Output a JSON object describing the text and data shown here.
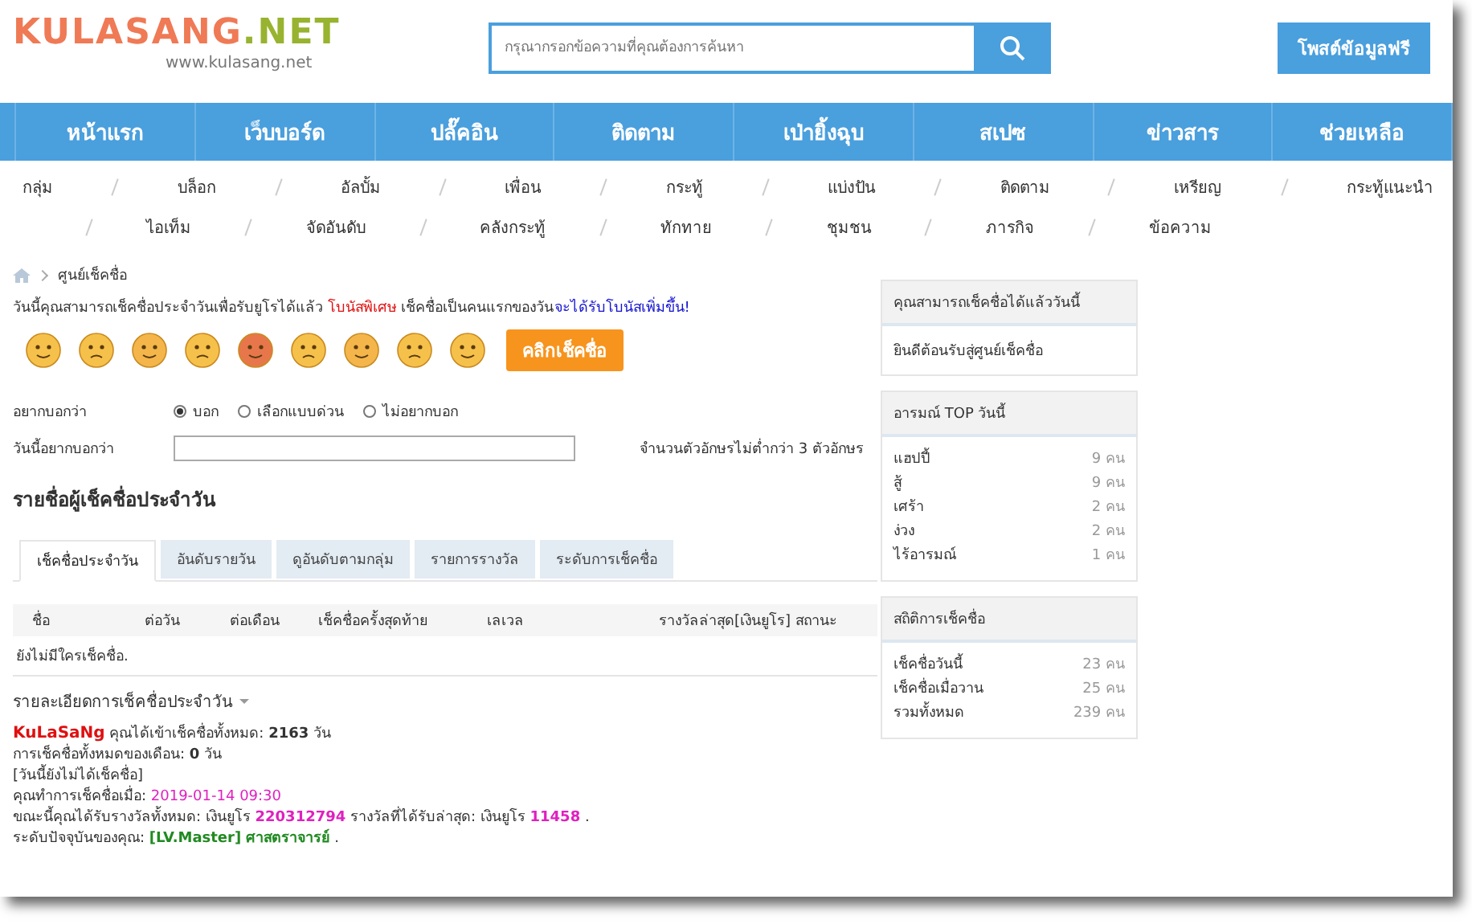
{
  "header": {
    "logo": {
      "name": "KULASANG",
      "suffix": ".NET",
      "url": "www.kulasang.net"
    },
    "search": {
      "placeholder": "กรุณากรอกข้อความที่คุณต้องการค้นหา"
    },
    "post_button": "โพสต์ข้อมูลฟรี"
  },
  "main_nav": [
    "หน้าแรก",
    "เว็บบอร์ด",
    "ปลั๊คอิน",
    "ติดตาม",
    "เป่ายิ้งฉุบ",
    "สเปซ",
    "ข่าวสาร",
    "ช่วยเหลือ"
  ],
  "sub_nav": [
    [
      "กลุ่ม",
      "บล็อก",
      "อัลบั้ม",
      "เพื่อน",
      "กระทู้",
      "แบ่งปัน",
      "ติดตาม",
      "เหรียญ",
      "กระทู้แนะนำ"
    ],
    [
      "ไอเท็ม",
      "จัดอันดับ",
      "คลังกระทู้",
      "ทักทาย",
      "ชุมชน",
      "ภารกิจ",
      "ข้อความ"
    ]
  ],
  "breadcrumb": [
    "ศูนย์เช็คชื่อ"
  ],
  "intro": [
    {
      "kind": "plain",
      "text": "วันนี้คุณสามารถเช็คชื่อประจำวันเพื่อรับยูโรได้แล้ว "
    },
    {
      "kind": "red",
      "text": "โบนัสพิเศษ"
    },
    {
      "kind": "plain",
      "text": " เช็คชื่อเป็นคนแรกของวัน"
    },
    {
      "kind": "blue",
      "text": "จะได้รับโบนัสเพิ่มขึ้น!"
    }
  ],
  "checkin_button": "คลิกเช็คชื่อ",
  "say_label": "อยากบอกว่า",
  "say_options": [
    {
      "label": "บอก",
      "selected": true
    },
    {
      "label": "เลือกแบบด่วน",
      "selected": false
    },
    {
      "label": "ไม่อยากบอก",
      "selected": false
    }
  ],
  "message_label": "วันนี้อยากบอกว่า",
  "message_hint": "จำนวนตัวอักษรไม่ต่ำกว่า 3 ตัวอักษร",
  "list_title": "รายชื่อผู้เช็คชื่อประจำวัน",
  "tabs": [
    {
      "label": "เช็คชื่อประจำวัน",
      "selected": true
    },
    {
      "label": "อันดับรายวัน",
      "selected": false
    },
    {
      "label": "ดูอันดับตามกลุ่ม",
      "selected": false
    },
    {
      "label": "รายการรางวัล",
      "selected": false
    },
    {
      "label": "ระดับการเช็คชื่อ",
      "selected": false
    }
  ],
  "table": {
    "columns": [
      "ชื่อ",
      "ต่อวัน",
      "ต่อเดือน",
      "เช็คชื่อครั้งสุดท้าย",
      "เลเวล",
      "รางวัลล่าสุด[เงินยูโร]",
      "สถานะ"
    ],
    "empty": "ยังไม่มีใครเช็คชื่อ."
  },
  "details": {
    "title": "รายละเอียดการเช็คชื่อประจำวัน",
    "lines": [
      [
        {
          "kind": "name",
          "text": "KuLaSaNg"
        },
        {
          "kind": "plain",
          "text": " คุณได้เข้าเช็คชื่อทั้งหมด: "
        },
        {
          "kind": "bold",
          "text": "2163"
        },
        {
          "kind": "plain",
          "text": " วัน"
        }
      ],
      [
        {
          "kind": "plain",
          "text": "การเช็คชื่อทั้งหมดของเดือน: "
        },
        {
          "kind": "bold",
          "text": "0"
        },
        {
          "kind": "plain",
          "text": " วัน"
        }
      ],
      [
        {
          "kind": "plain",
          "text": " [วันนี้ยังไม่ได้เช็คชื่อ]"
        }
      ],
      [
        {
          "kind": "plain",
          "text": "คุณทำการเช็คชื่อเมื่อ: "
        },
        {
          "kind": "date",
          "text": "2019-01-14 09:30"
        }
      ],
      [
        {
          "kind": "plain",
          "text": "ขณะนี้คุณได้รับรางวัลทั้งหมด: เงินยูโร "
        },
        {
          "kind": "number",
          "text": "220312794"
        },
        {
          "kind": "plain",
          "text": " รางวัลที่ได้รับล่าสุด: เงินยูโร "
        },
        {
          "kind": "number",
          "text": "11458"
        },
        {
          "kind": "plain",
          "text": " ."
        }
      ],
      [
        {
          "kind": "plain",
          "text": "ระดับปัจจุบันของคุณ: "
        },
        {
          "kind": "level",
          "text": "[LV.Master] ศาสตราจารย์"
        },
        {
          "kind": "plain",
          "text": " ."
        }
      ]
    ]
  },
  "sidebar": [
    {
      "title": "คุณสามารถเช็คชื่อได้แล้ววันนี้",
      "text": "ยินดีต้อนรับสู่ศูนย์เช็คชื่อ"
    },
    {
      "title": "อารมณ์ TOP วันนี้",
      "rows": [
        {
          "label": "แฮปปี้",
          "value": "9 คน"
        },
        {
          "label": "สู้",
          "value": "9 คน"
        },
        {
          "label": "เศร้า",
          "value": "2 คน"
        },
        {
          "label": "ง่วง",
          "value": "2 คน"
        },
        {
          "label": "ไร้อารมณ์",
          "value": "1 คน"
        }
      ]
    },
    {
      "title": "สถิติการเช็คชื่อ",
      "rows": [
        {
          "label": "เช็คชื่อวันนี้",
          "value": "23 คน"
        },
        {
          "label": "เช็คชื่อเมื่อวาน",
          "value": "25 คน"
        },
        {
          "label": "รวมทั้งหมด",
          "value": "239 คน"
        }
      ]
    }
  ]
}
